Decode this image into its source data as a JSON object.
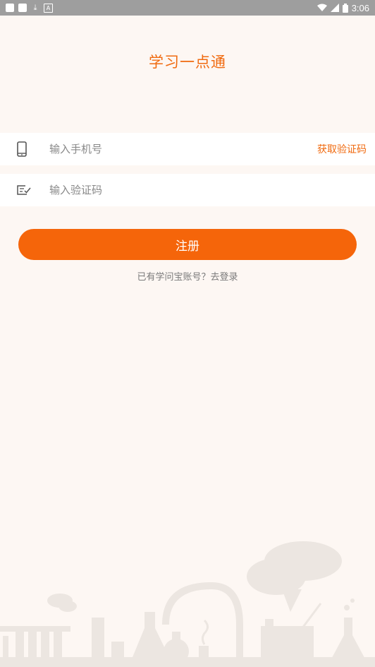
{
  "status_bar": {
    "time": "3:06"
  },
  "app": {
    "title": "学习一点通"
  },
  "form": {
    "phone_placeholder": "输入手机号",
    "get_code_label": "获取验证码",
    "code_placeholder": "输入验证码",
    "register_label": "注册",
    "login_prompt": "已有学问宝账号？去登录"
  },
  "colors": {
    "accent": "#f5650a",
    "background": "#fdf7f3"
  },
  "icons": {
    "phone": "phone-icon",
    "code": "verify-code-icon"
  }
}
